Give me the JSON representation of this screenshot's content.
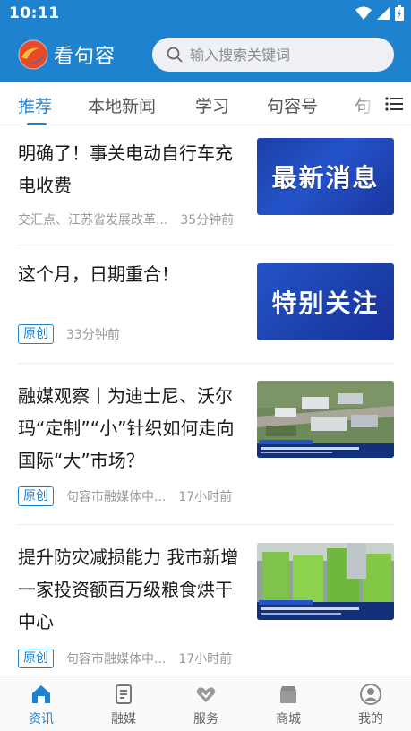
{
  "status_bar": {
    "time": "10:11",
    "icons": [
      "wifi-icon",
      "signal-icon",
      "battery-icon"
    ]
  },
  "header": {
    "app_name": "看句容",
    "search_placeholder": "输入搜索关键词"
  },
  "tabs": [
    {
      "label": "推荐",
      "active": true
    },
    {
      "label": "本地新闻",
      "active": false
    },
    {
      "label": "学习",
      "active": false
    },
    {
      "label": "句容号",
      "active": false
    },
    {
      "label": "句",
      "active": false
    }
  ],
  "feed": [
    {
      "title": "明确了！事关电动自行车充电收费",
      "badge": "",
      "source": "交汇点、江苏省发展改革...",
      "time": "35分钟前",
      "thumb_text": "最新消息"
    },
    {
      "title": "这个月，日期重合！",
      "badge": "原创",
      "source": "",
      "time": "33分钟前",
      "thumb_text": "特别关注"
    },
    {
      "title": "融媒观察丨为迪士尼、沃尔玛“定制”“小”针织如何走向国际“大”市场？",
      "badge": "原创",
      "source": "句容市融媒体中...",
      "time": "17小时前",
      "thumb_text": ""
    },
    {
      "title": "提升防灾减损能力 我市新增一家投资额百万级粮食烘干中心",
      "badge": "原创",
      "source": "句容市融媒体中...",
      "time": "17小时前",
      "thumb_text": ""
    }
  ],
  "bottom_nav": [
    {
      "label": "资讯",
      "icon": "home-icon",
      "active": true
    },
    {
      "label": "融媒",
      "icon": "document-icon",
      "active": false
    },
    {
      "label": "服务",
      "icon": "heart-hands-icon",
      "active": false
    },
    {
      "label": "商城",
      "icon": "shop-icon",
      "active": false
    },
    {
      "label": "我的",
      "icon": "user-icon",
      "active": false
    }
  ],
  "colors": {
    "accent": "#1f82cf",
    "header_bg": "#1f82cf"
  }
}
